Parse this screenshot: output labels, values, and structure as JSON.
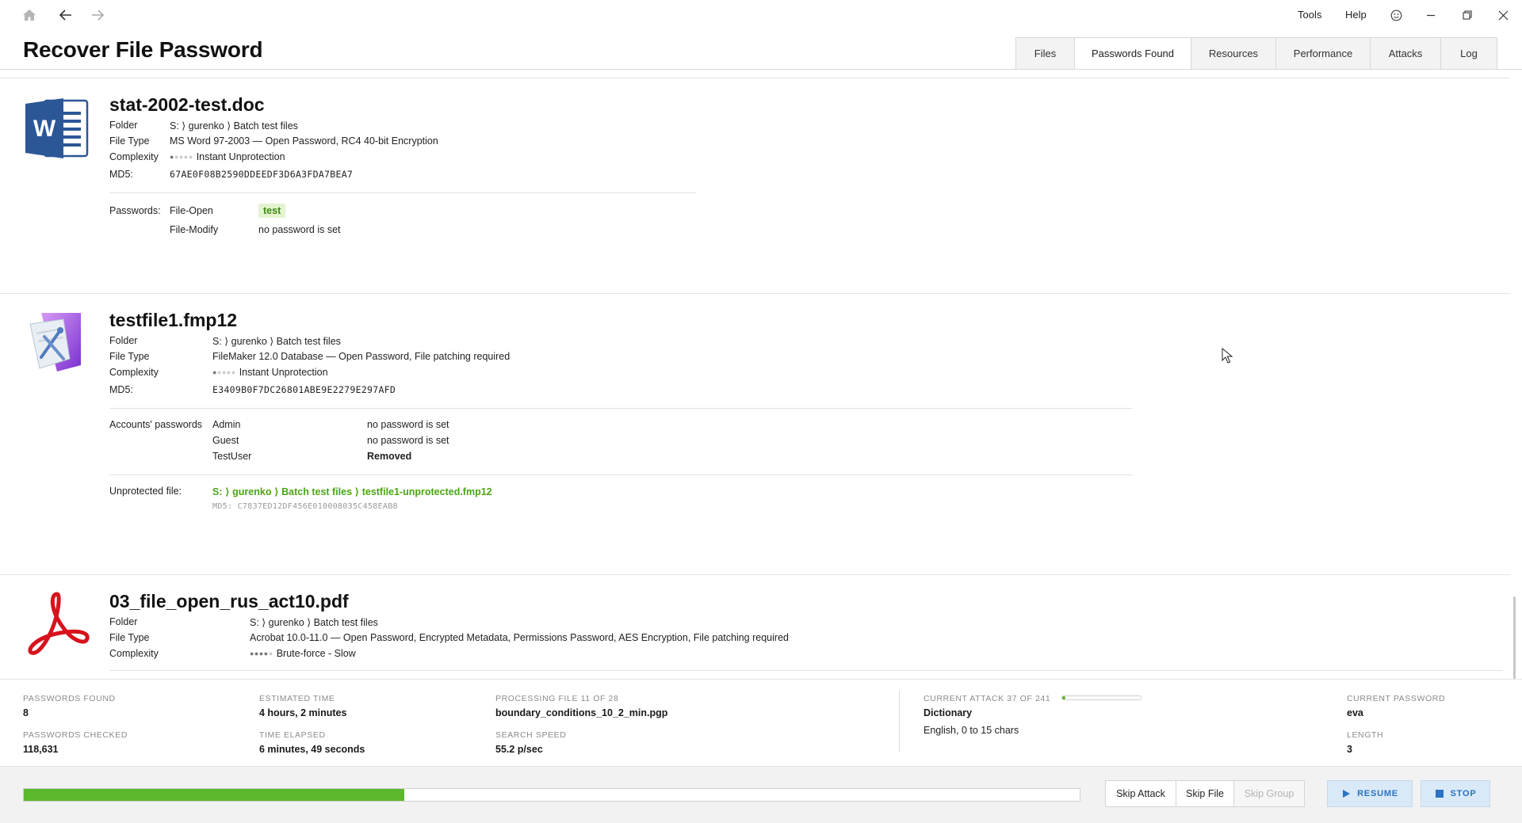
{
  "app": {
    "title": "Recover File Password"
  },
  "titlebar": {
    "menu": {
      "tools": "Tools",
      "help": "Help"
    },
    "icons": [
      "home-icon",
      "back-arrow-icon",
      "forward-arrow-icon",
      "smiley-feedback-icon",
      "minimize-icon",
      "restore-icon",
      "close-icon"
    ]
  },
  "tabs": [
    {
      "label": "Files",
      "active": false
    },
    {
      "label": "Passwords Found",
      "active": true
    },
    {
      "label": "Resources",
      "active": false
    },
    {
      "label": "Performance",
      "active": false
    },
    {
      "label": "Attacks",
      "active": false
    },
    {
      "label": "Log",
      "active": false
    }
  ],
  "labels": {
    "folder": "Folder",
    "file_type": "File Type",
    "complexity": "Complexity",
    "md5": "MD5:",
    "passwords": "Passwords:",
    "accounts_passwords": "Accounts' passwords",
    "unprotected_file": "Unprotected file:"
  },
  "files": [
    {
      "name": "stat-2002-test.doc",
      "icon": "word-document-icon",
      "folder": "S: ⟩ gurenko ⟩ Batch test files",
      "file_type": "MS Word 97-2003 — Open Password, RC4 40-bit Encryption",
      "complexity_level": 1,
      "complexity": "Instant Unprotection",
      "md5": "67AE0F08B2590DDEEDF3D6A3FDA7BEA7",
      "passwords": [
        {
          "type": "File-Open",
          "value": "test",
          "found": true
        },
        {
          "type": "File-Modify",
          "value": "no password is set",
          "found": false
        }
      ]
    },
    {
      "name": "testfile1.fmp12",
      "icon": "filemaker-icon",
      "folder": "S: ⟩ gurenko ⟩ Batch test files",
      "file_type": "FileMaker 12.0 Database — Open Password, File patching required",
      "complexity_level": 1,
      "complexity": "Instant Unprotection",
      "md5": "E3409B0F7DC26801ABE9E2279E297AFD",
      "accounts": [
        {
          "name": "Admin",
          "value": "no password is set",
          "bold": false
        },
        {
          "name": "Guest",
          "value": "no password is set",
          "bold": false
        },
        {
          "name": "TestUser",
          "value": "Removed",
          "bold": true
        }
      ],
      "unprotected_path": "S: ⟩ gurenko ⟩ Batch test files ⟩ testfile1-unprotected.fmp12",
      "unprotected_md5": "MD5: C7837ED12DF456E010008035C458EAB8"
    },
    {
      "name": "03_file_open_rus_act10.pdf",
      "icon": "acrobat-pdf-icon",
      "folder": "S: ⟩ gurenko ⟩ Batch test files",
      "file_type": "Acrobat 10.0-11.0 — Open Password, Encrypted Metadata, Permissions Password, AES Encryption, File patching required",
      "complexity_level": 4,
      "complexity": "Brute-force - Slow"
    }
  ],
  "status": {
    "passwords_found_label": "PASSWORDS FOUND",
    "passwords_found": "8",
    "passwords_checked_label": "PASSWORDS CHECKED",
    "passwords_checked": "118,631",
    "estimated_time_label": "ESTIMATED TIME",
    "estimated_time": "4 hours, 2 minutes",
    "time_elapsed_label": "TIME ELAPSED",
    "time_elapsed": "6 minutes, 49 seconds",
    "processing_file_label": "PROCESSING FILE 11 OF 28",
    "processing_file": "boundary_conditions_10_2_min.pgp",
    "search_speed_label": "SEARCH SPEED",
    "search_speed": "55.2 p/sec",
    "current_attack_label": "CURRENT ATTACK 37 OF 241",
    "current_attack": "Dictionary",
    "current_attack_detail": "English, 0 to 15 chars",
    "attack_progress": 0.03,
    "current_password_label": "CURRENT PASSWORD",
    "current_password": "eva",
    "length_label": "LENGTH",
    "length": "3"
  },
  "bottom": {
    "overall_progress": 0.36,
    "skip_attack": "Skip Attack",
    "skip_file": "Skip File",
    "skip_group": "Skip Group",
    "resume": "RESUME",
    "stop": "STOP"
  },
  "colors": {
    "accent_green": "#5cb82c",
    "found_green": "#4aa512",
    "action_blue": "#2a72c2"
  }
}
